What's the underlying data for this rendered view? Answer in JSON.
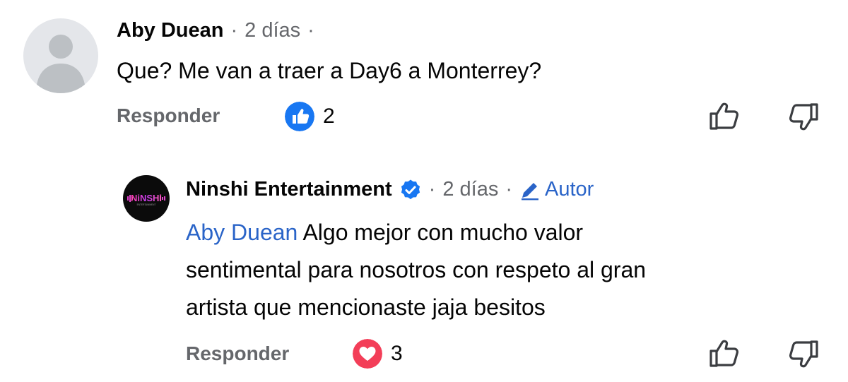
{
  "comment": {
    "author": "Aby Duean",
    "dot1": "·",
    "time": "2 días",
    "dot2": "·",
    "text": "Que? Me van a traer a Day6 a Monterrey?",
    "reply_label": "Responder",
    "reaction_icon": "like-icon",
    "reaction_count": "2"
  },
  "reply": {
    "author": "Ninshi Entertainment",
    "verified_icon": "verified-badge-icon",
    "dot1": "·",
    "time": "2 días",
    "dot2": "·",
    "badge_label": "Autor",
    "mention": "Aby Duean",
    "text_line1": " Algo mejor con mucho valor",
    "text_line2": "sentimental para nosotros con respeto al gran",
    "text_line3": "artista que mencionaste jaja besitos",
    "reply_label": "Responder",
    "reaction_icon": "love-icon",
    "reaction_count": "3",
    "avatar_logo_text": "NiNSHi",
    "avatar_sub_text": "ENTERTAINMENT"
  },
  "colors": {
    "like_blue": "#1877f2",
    "love_red": "#f33e58",
    "secondary_text": "#65676b",
    "link_blue": "#2a64c8"
  }
}
